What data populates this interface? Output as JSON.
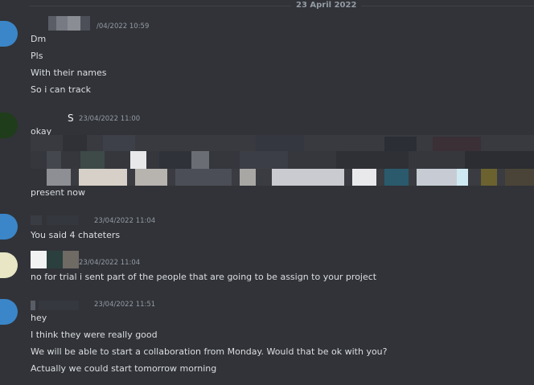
{
  "divider": {
    "date_label": "23 April 2022"
  },
  "groups": [
    {
      "timestamp": "/04/2022 10:59",
      "messages": [
        "Dm",
        "Pls",
        "With their names",
        "So i can track"
      ]
    },
    {
      "author_fragment": "S",
      "timestamp": "23/04/2022 11:00",
      "messages": [
        "okay",
        "present now"
      ]
    },
    {
      "timestamp": "23/04/2022 11:04",
      "messages": [
        "You said 4 chateters"
      ]
    },
    {
      "timestamp": "23/04/2022 11:04",
      "messages": [
        "no for trial i sent part of the people that are going to be assign to your project"
      ]
    },
    {
      "timestamp": "23/04/2022 11:51",
      "messages": [
        "hey",
        "I think they were really good",
        "We will be able to start a collaboration from Monday. Would that be ok with you?",
        "Actually we could start tomorrow morning"
      ]
    }
  ],
  "colors": {
    "background": "#313338",
    "text": "#dbdee1",
    "muted": "#949ba4",
    "avatar_blue": "#3b86c8",
    "avatar_green": "#1f3d1a"
  }
}
